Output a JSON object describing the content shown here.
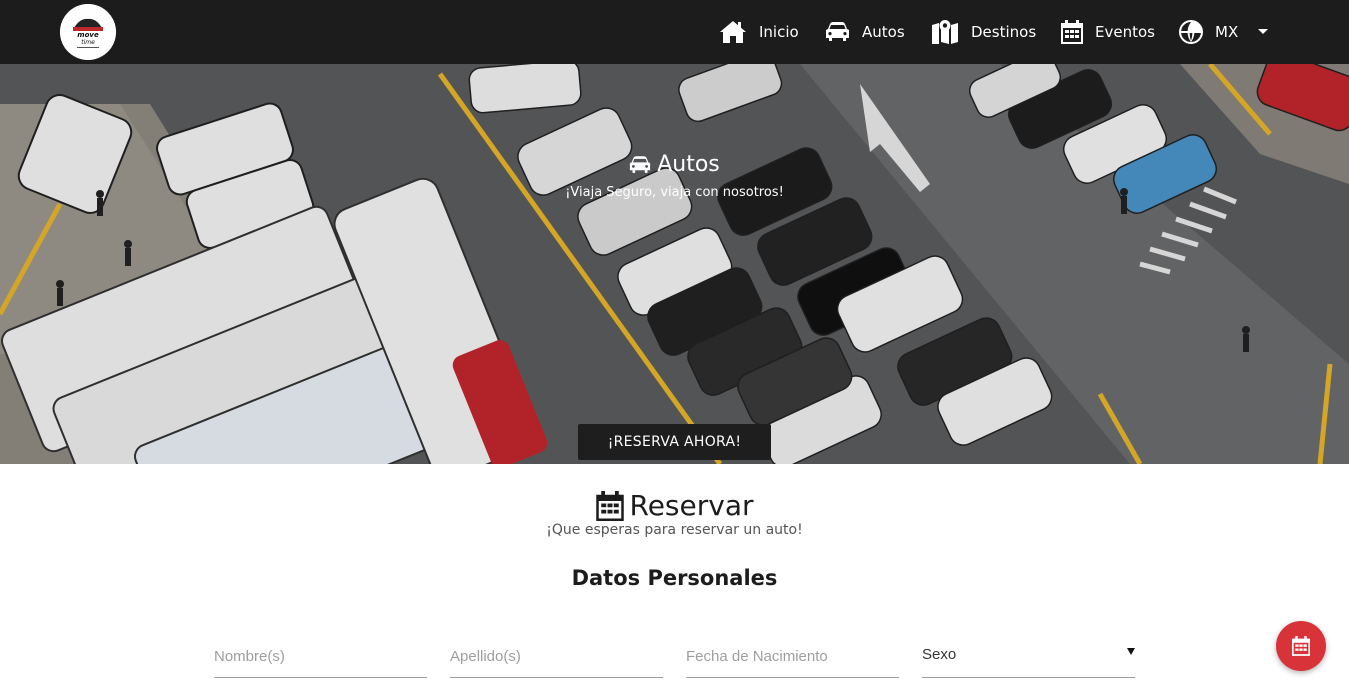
{
  "navbar": {
    "logo_text": "move time",
    "items": [
      {
        "label": "Inicio",
        "icon": "home-icon"
      },
      {
        "label": "Autos",
        "icon": "car-icon"
      },
      {
        "label": "Destinos",
        "icon": "map-icon"
      },
      {
        "label": "Eventos",
        "icon": "calendar-icon"
      }
    ],
    "language": {
      "label": "MX",
      "icon": "globe-icon"
    }
  },
  "hero": {
    "title": "Autos",
    "subtitle": "¡Viaja Seguro, viaja con nosotros!",
    "button": "¡RESERVA AHORA!",
    "slides": 3,
    "active_slide": 1
  },
  "reserve": {
    "title": "Reservar",
    "subtitle": "¡Que esperas para reservar un auto!",
    "section_heading": "Datos Personales",
    "fields": {
      "first_name_placeholder": "Nombre(s)",
      "last_name_placeholder": "Apellido(s)",
      "birthdate_placeholder": "Fecha de Nacimiento",
      "sex_value": "Sexo"
    }
  },
  "colors": {
    "navbar": "#1c1c1c",
    "fab": "#d9333a",
    "button": "#1e1e1e"
  }
}
